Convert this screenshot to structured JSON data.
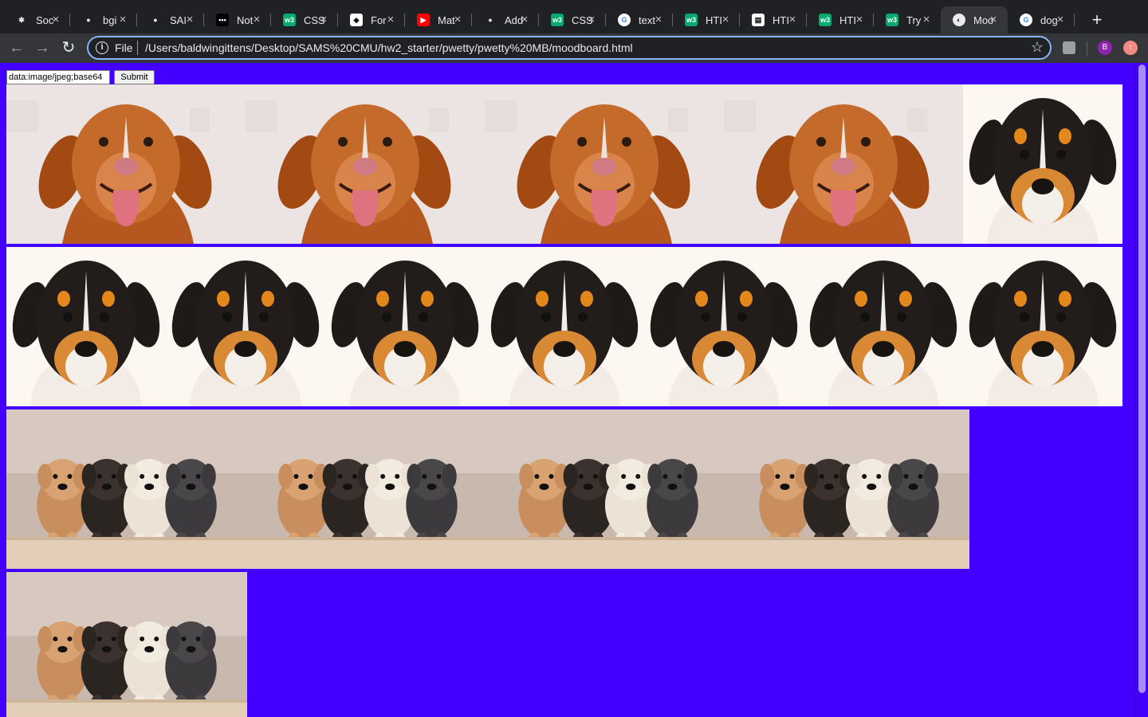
{
  "browser": {
    "tabs": [
      {
        "title": "Soc",
        "icon": "dark-logo-icon"
      },
      {
        "title": "bgi",
        "icon": "github-icon"
      },
      {
        "title": "SAI",
        "icon": "github-icon"
      },
      {
        "title": "Not",
        "icon": "dots-icon"
      },
      {
        "title": "CSS",
        "icon": "w3-icon"
      },
      {
        "title": "For",
        "icon": "codepen-icon"
      },
      {
        "title": "Mat",
        "icon": "youtube-icon"
      },
      {
        "title": "Add",
        "icon": "github-icon"
      },
      {
        "title": "CSS",
        "icon": "w3-icon"
      },
      {
        "title": "text",
        "icon": "google-icon"
      },
      {
        "title": "HTI",
        "icon": "w3-icon"
      },
      {
        "title": "HTI",
        "icon": "doc-icon"
      },
      {
        "title": "HTI",
        "icon": "w3-icon"
      },
      {
        "title": "Try",
        "icon": "w3-icon"
      },
      {
        "title": "Moo",
        "icon": "globe-icon",
        "active": true
      },
      {
        "title": "dog",
        "icon": "google-icon"
      }
    ],
    "address": {
      "scheme": "File",
      "url": "/Users/baldwingittens/Desktop/SAMS%20CMU/hw2_starter/pwetty/pwetty%20MB/moodboard.html"
    },
    "profile_initial": "B"
  },
  "page": {
    "background": "#4400ff",
    "input_value": "data:image/jpeg;base64",
    "submit_label": "Submit",
    "rows": [
      [
        {
          "kind": "toller",
          "alt": "golden puppy"
        },
        {
          "kind": "toller",
          "alt": "golden puppy"
        },
        {
          "kind": "toller",
          "alt": "golden puppy"
        },
        {
          "kind": "toller",
          "alt": "golden puppy"
        },
        {
          "kind": "tricolor",
          "alt": "tricolor puppy"
        }
      ],
      [
        {
          "kind": "tricolor",
          "alt": "tricolor puppy"
        },
        {
          "kind": "tricolor",
          "alt": "tricolor puppy"
        },
        {
          "kind": "tricolor",
          "alt": "tricolor puppy"
        },
        {
          "kind": "tricolor",
          "alt": "tricolor puppy"
        },
        {
          "kind": "tricolor",
          "alt": "tricolor puppy"
        },
        {
          "kind": "tricolor",
          "alt": "tricolor puppy"
        },
        {
          "kind": "tricolor",
          "alt": "tricolor puppy"
        }
      ],
      [
        {
          "kind": "group",
          "alt": "four puppies"
        },
        {
          "kind": "group",
          "alt": "four puppies"
        },
        {
          "kind": "group",
          "alt": "four puppies"
        },
        {
          "kind": "group",
          "alt": "four puppies"
        }
      ],
      [
        {
          "kind": "group",
          "alt": "four puppies"
        }
      ]
    ]
  }
}
